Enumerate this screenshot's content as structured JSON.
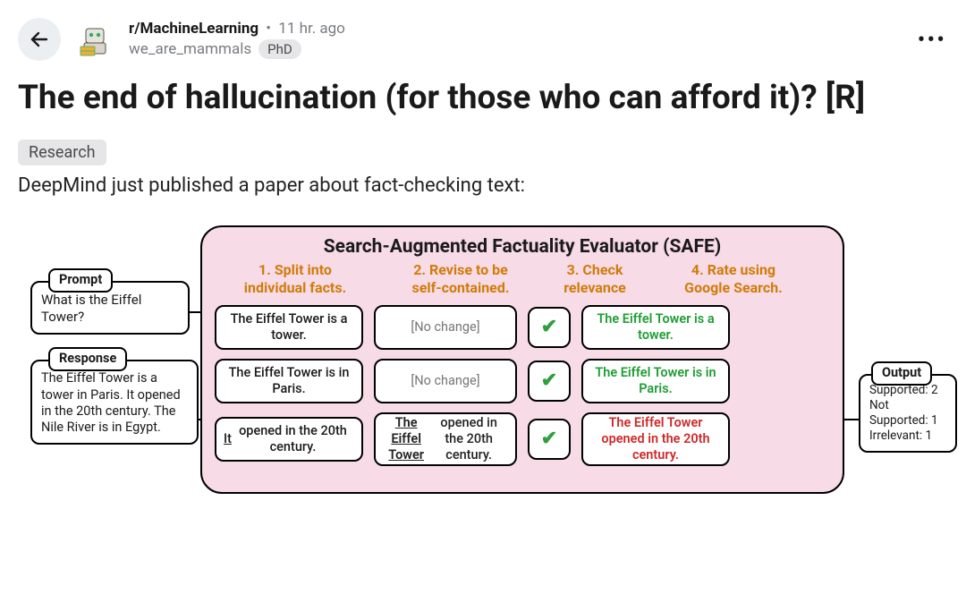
{
  "header": {
    "subreddit": "r/MachineLearning",
    "separator": "•",
    "age": "11 hr. ago",
    "user": "we_are_mammals",
    "user_flair": "PhD"
  },
  "post": {
    "title": "The end of hallucination (for those who can afford it)? [R]",
    "link_flair": "Research",
    "body": "DeepMind just published a paper about fact-checking text:"
  },
  "diagram": {
    "safe_title": "Search-Augmented Factuality Evaluator (SAFE)",
    "steps": {
      "s1a": "1. Split into",
      "s1b": "individual facts.",
      "s2a": "2. Revise to be",
      "s2b": "self-contained.",
      "s3a": "3. Check",
      "s3b": "relevance",
      "s4a": "4. Rate using",
      "s4b": "Google Search."
    },
    "rows": [
      {
        "fact": "The Eiffel Tower is a tower.",
        "revise": "[No change]",
        "check": "✔",
        "rate": "The Eiffel Tower is a tower.",
        "rate_class": "green",
        "revise_html": "[No change]"
      },
      {
        "fact": "The Eiffel Tower is in Paris.",
        "revise": "[No change]",
        "check": "✔",
        "rate": "The Eiffel Tower is in Paris.",
        "rate_class": "green",
        "revise_html": "[No change]"
      },
      {
        "fact_html": "<u>It</u> opened in the 20th century.",
        "revise_html": "<span class='underline'>The Eiffel Tower</span> opened in the 20th century.",
        "check": "✔",
        "rate": "The Eiffel Tower opened in the 20th century.",
        "rate_class": "red"
      }
    ],
    "prompt": {
      "label": "Prompt",
      "text": "What is the Eiffel Tower?"
    },
    "response": {
      "label": "Response",
      "text": "The Eiffel Tower is a tower in Paris. It opened in the 20th century. The Nile River is in Egypt."
    },
    "output": {
      "label": "Output",
      "line1": "Supported: 2",
      "line2": "Not Supported: 1",
      "line3": "Irrelevant: 1"
    }
  }
}
